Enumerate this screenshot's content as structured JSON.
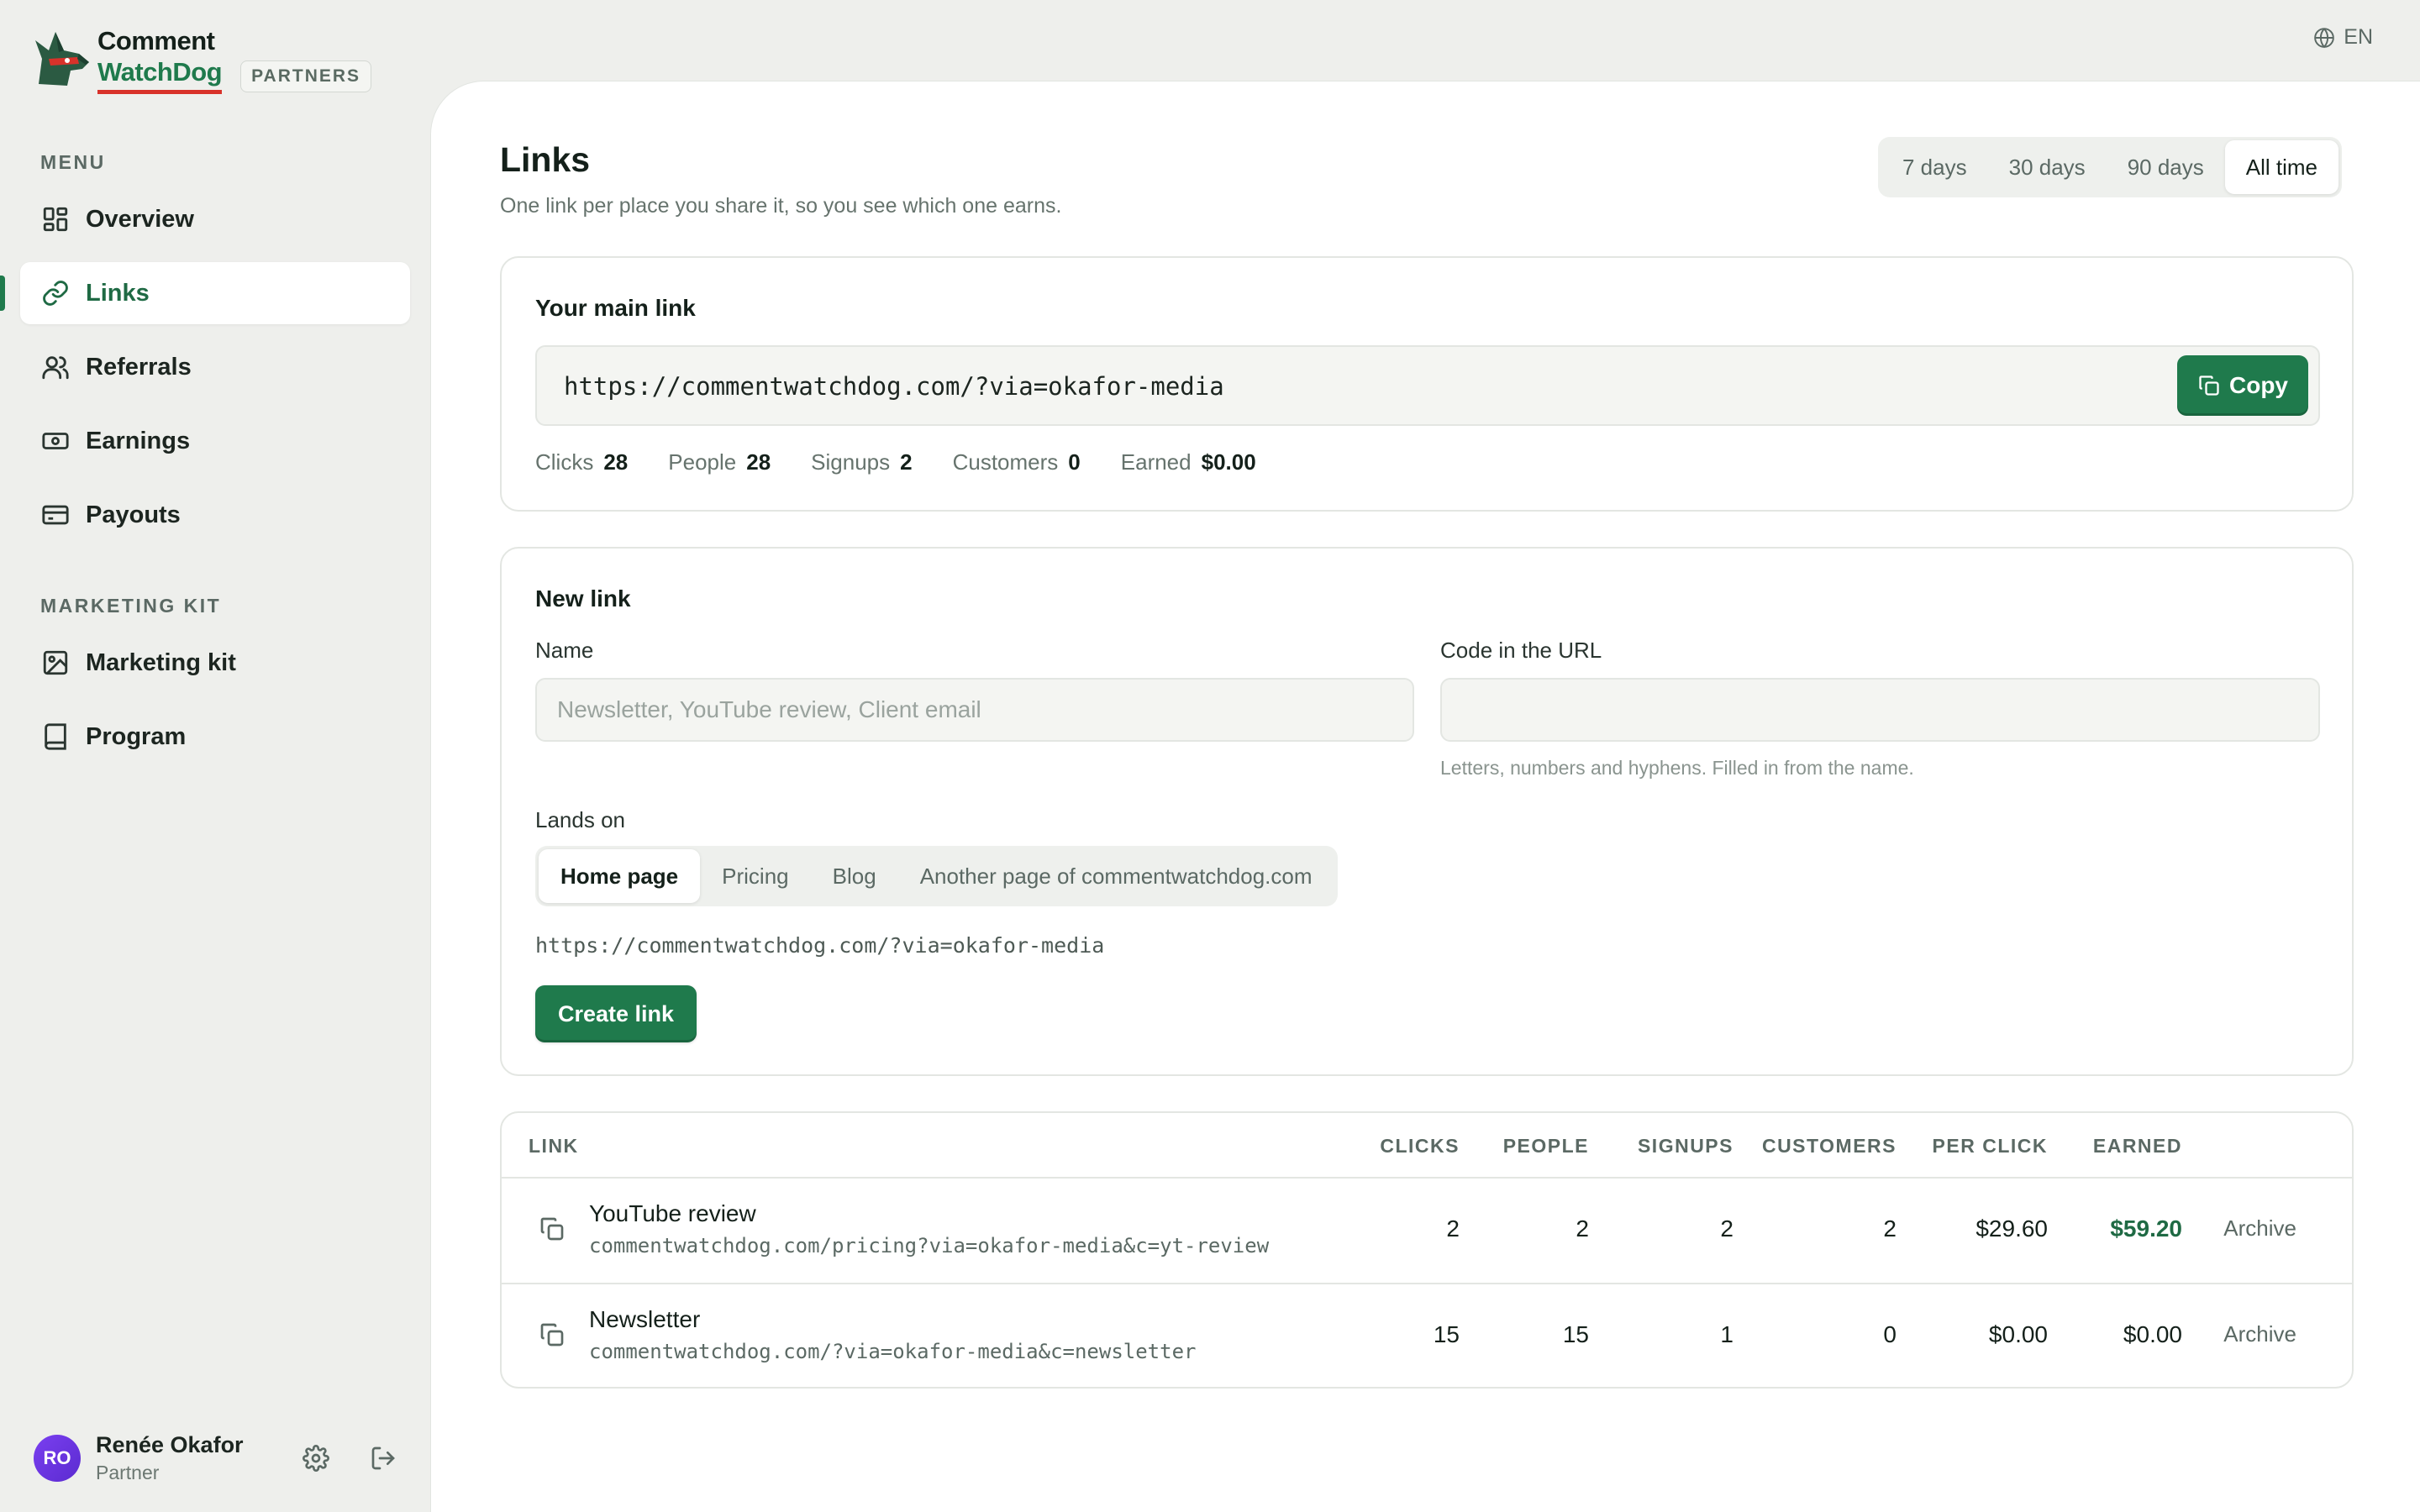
{
  "brand": {
    "line1": "Comment",
    "line2": "WatchDog",
    "badge": "PARTNERS"
  },
  "language": "EN",
  "sidebar": {
    "menu_label": "MENU",
    "items": [
      {
        "label": "Overview",
        "icon": "grid-icon"
      },
      {
        "label": "Links",
        "icon": "link-icon",
        "active": true
      },
      {
        "label": "Referrals",
        "icon": "users-icon"
      },
      {
        "label": "Earnings",
        "icon": "banknote-icon"
      },
      {
        "label": "Payouts",
        "icon": "credit-card-icon"
      }
    ],
    "kit_label": "MARKETING KIT",
    "kit_items": [
      {
        "label": "Marketing kit",
        "icon": "image-icon"
      },
      {
        "label": "Program",
        "icon": "book-icon"
      }
    ]
  },
  "user": {
    "initials": "RO",
    "name": "Renée Okafor",
    "role": "Partner"
  },
  "page": {
    "title": "Links",
    "subtitle": "One link per place you share it, so you see which one earns."
  },
  "range": {
    "options": [
      "7 days",
      "30 days",
      "90 days",
      "All time"
    ],
    "selected": "All time"
  },
  "main_link": {
    "title": "Your main link",
    "url": "https://commentwatchdog.com/?via=okafor-media",
    "copy_label": "Copy",
    "stats": [
      {
        "label": "Clicks",
        "value": "28"
      },
      {
        "label": "People",
        "value": "28"
      },
      {
        "label": "Signups",
        "value": "2"
      },
      {
        "label": "Customers",
        "value": "0"
      },
      {
        "label": "Earned",
        "value": "$0.00"
      }
    ]
  },
  "new_link": {
    "title": "New link",
    "name_label": "Name",
    "name_placeholder": "Newsletter, YouTube review, Client email",
    "name_value": "",
    "code_label": "Code in the URL",
    "code_value": "",
    "code_hint": "Letters, numbers and hyphens. Filled in from the name.",
    "lands_label": "Lands on",
    "lands_options": [
      "Home page",
      "Pricing",
      "Blog",
      "Another page of commentwatchdog.com"
    ],
    "lands_selected": "Home page",
    "preview_url": "https://commentwatchdog.com/?via=okafor-media",
    "create_label": "Create link"
  },
  "table": {
    "headers": {
      "link": "LINK",
      "clicks": "CLICKS",
      "people": "PEOPLE",
      "signups": "SIGNUPS",
      "customers": "CUSTOMERS",
      "per_click": "PER CLICK",
      "earned": "EARNED"
    },
    "rows": [
      {
        "name": "YouTube review",
        "url": "commentwatchdog.com/pricing?via=okafor-media&c=yt-review",
        "clicks": "2",
        "people": "2",
        "signups": "2",
        "customers": "2",
        "per_click": "$29.60",
        "earned": "$59.20",
        "earned_positive": true,
        "action": "Archive"
      },
      {
        "name": "Newsletter",
        "url": "commentwatchdog.com/?via=okafor-media&c=newsletter",
        "clicks": "15",
        "people": "15",
        "signups": "1",
        "customers": "0",
        "per_click": "$0.00",
        "earned": "$0.00",
        "earned_positive": false,
        "action": "Archive"
      }
    ]
  },
  "colors": {
    "accent": "#1f7a4c",
    "brand_red": "#d8322a",
    "avatar": "#6a35e0"
  }
}
